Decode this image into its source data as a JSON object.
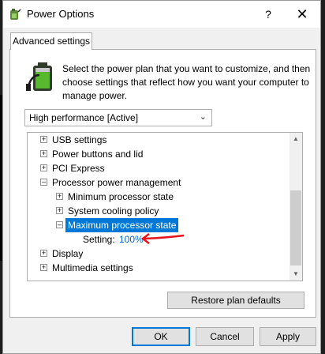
{
  "window": {
    "title": "Power Options"
  },
  "tabs": [
    {
      "label": "Advanced settings"
    }
  ],
  "intro_text": "Select the power plan that you want to customize, and then choose settings that reflect how you want your computer to manage power.",
  "plan_select": {
    "value": "High performance [Active]"
  },
  "tree": {
    "items": [
      {
        "label": "USB settings"
      },
      {
        "label": "Power buttons and lid"
      },
      {
        "label": "PCI Express"
      },
      {
        "label": "Processor power management"
      },
      {
        "label": "Minimum processor state"
      },
      {
        "label": "System cooling policy"
      },
      {
        "label": "Maximum processor state"
      },
      {
        "label": "Display"
      },
      {
        "label": "Multimedia settings"
      }
    ],
    "setting": {
      "label": "Setting:",
      "value": "100%"
    }
  },
  "buttons": {
    "restore": "Restore plan defaults",
    "ok": "OK",
    "cancel": "Cancel",
    "apply": "Apply"
  },
  "title_buttons": {
    "help": "?",
    "close": "✕"
  },
  "colors": {
    "selection": "#0078d7",
    "link": "#0066cc",
    "annotation_arrow": "#e8141b"
  },
  "icons": [
    "power-options-icon",
    "battery-plan-icon",
    "chevron-down-icon",
    "expand-icon",
    "collapse-icon",
    "scroll-up-icon",
    "scroll-down-icon"
  ]
}
